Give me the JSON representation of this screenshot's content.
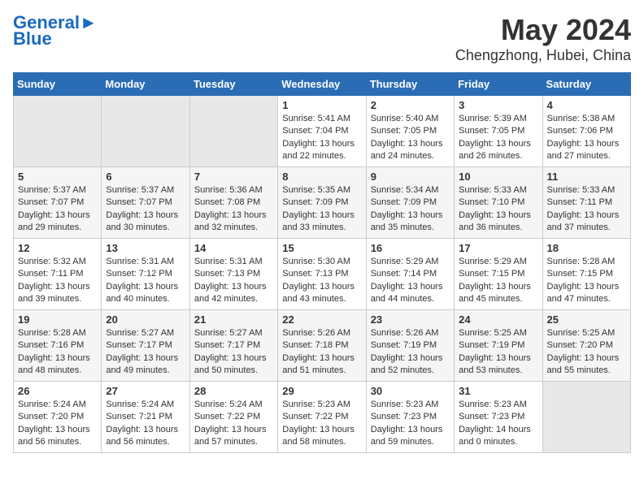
{
  "logo": {
    "line1": "General",
    "line2": "Blue"
  },
  "title": "May 2024",
  "location": "Chengzhong, Hubei, China",
  "days_of_week": [
    "Sunday",
    "Monday",
    "Tuesday",
    "Wednesday",
    "Thursday",
    "Friday",
    "Saturday"
  ],
  "weeks": [
    [
      {
        "day": "",
        "sunrise": "",
        "sunset": "",
        "daylight": ""
      },
      {
        "day": "",
        "sunrise": "",
        "sunset": "",
        "daylight": ""
      },
      {
        "day": "",
        "sunrise": "",
        "sunset": "",
        "daylight": ""
      },
      {
        "day": "1",
        "sunrise": "Sunrise: 5:41 AM",
        "sunset": "Sunset: 7:04 PM",
        "daylight": "Daylight: 13 hours and 22 minutes."
      },
      {
        "day": "2",
        "sunrise": "Sunrise: 5:40 AM",
        "sunset": "Sunset: 7:05 PM",
        "daylight": "Daylight: 13 hours and 24 minutes."
      },
      {
        "day": "3",
        "sunrise": "Sunrise: 5:39 AM",
        "sunset": "Sunset: 7:05 PM",
        "daylight": "Daylight: 13 hours and 26 minutes."
      },
      {
        "day": "4",
        "sunrise": "Sunrise: 5:38 AM",
        "sunset": "Sunset: 7:06 PM",
        "daylight": "Daylight: 13 hours and 27 minutes."
      }
    ],
    [
      {
        "day": "5",
        "sunrise": "Sunrise: 5:37 AM",
        "sunset": "Sunset: 7:07 PM",
        "daylight": "Daylight: 13 hours and 29 minutes."
      },
      {
        "day": "6",
        "sunrise": "Sunrise: 5:37 AM",
        "sunset": "Sunset: 7:07 PM",
        "daylight": "Daylight: 13 hours and 30 minutes."
      },
      {
        "day": "7",
        "sunrise": "Sunrise: 5:36 AM",
        "sunset": "Sunset: 7:08 PM",
        "daylight": "Daylight: 13 hours and 32 minutes."
      },
      {
        "day": "8",
        "sunrise": "Sunrise: 5:35 AM",
        "sunset": "Sunset: 7:09 PM",
        "daylight": "Daylight: 13 hours and 33 minutes."
      },
      {
        "day": "9",
        "sunrise": "Sunrise: 5:34 AM",
        "sunset": "Sunset: 7:09 PM",
        "daylight": "Daylight: 13 hours and 35 minutes."
      },
      {
        "day": "10",
        "sunrise": "Sunrise: 5:33 AM",
        "sunset": "Sunset: 7:10 PM",
        "daylight": "Daylight: 13 hours and 36 minutes."
      },
      {
        "day": "11",
        "sunrise": "Sunrise: 5:33 AM",
        "sunset": "Sunset: 7:11 PM",
        "daylight": "Daylight: 13 hours and 37 minutes."
      }
    ],
    [
      {
        "day": "12",
        "sunrise": "Sunrise: 5:32 AM",
        "sunset": "Sunset: 7:11 PM",
        "daylight": "Daylight: 13 hours and 39 minutes."
      },
      {
        "day": "13",
        "sunrise": "Sunrise: 5:31 AM",
        "sunset": "Sunset: 7:12 PM",
        "daylight": "Daylight: 13 hours and 40 minutes."
      },
      {
        "day": "14",
        "sunrise": "Sunrise: 5:31 AM",
        "sunset": "Sunset: 7:13 PM",
        "daylight": "Daylight: 13 hours and 42 minutes."
      },
      {
        "day": "15",
        "sunrise": "Sunrise: 5:30 AM",
        "sunset": "Sunset: 7:13 PM",
        "daylight": "Daylight: 13 hours and 43 minutes."
      },
      {
        "day": "16",
        "sunrise": "Sunrise: 5:29 AM",
        "sunset": "Sunset: 7:14 PM",
        "daylight": "Daylight: 13 hours and 44 minutes."
      },
      {
        "day": "17",
        "sunrise": "Sunrise: 5:29 AM",
        "sunset": "Sunset: 7:15 PM",
        "daylight": "Daylight: 13 hours and 45 minutes."
      },
      {
        "day": "18",
        "sunrise": "Sunrise: 5:28 AM",
        "sunset": "Sunset: 7:15 PM",
        "daylight": "Daylight: 13 hours and 47 minutes."
      }
    ],
    [
      {
        "day": "19",
        "sunrise": "Sunrise: 5:28 AM",
        "sunset": "Sunset: 7:16 PM",
        "daylight": "Daylight: 13 hours and 48 minutes."
      },
      {
        "day": "20",
        "sunrise": "Sunrise: 5:27 AM",
        "sunset": "Sunset: 7:17 PM",
        "daylight": "Daylight: 13 hours and 49 minutes."
      },
      {
        "day": "21",
        "sunrise": "Sunrise: 5:27 AM",
        "sunset": "Sunset: 7:17 PM",
        "daylight": "Daylight: 13 hours and 50 minutes."
      },
      {
        "day": "22",
        "sunrise": "Sunrise: 5:26 AM",
        "sunset": "Sunset: 7:18 PM",
        "daylight": "Daylight: 13 hours and 51 minutes."
      },
      {
        "day": "23",
        "sunrise": "Sunrise: 5:26 AM",
        "sunset": "Sunset: 7:19 PM",
        "daylight": "Daylight: 13 hours and 52 minutes."
      },
      {
        "day": "24",
        "sunrise": "Sunrise: 5:25 AM",
        "sunset": "Sunset: 7:19 PM",
        "daylight": "Daylight: 13 hours and 53 minutes."
      },
      {
        "day": "25",
        "sunrise": "Sunrise: 5:25 AM",
        "sunset": "Sunset: 7:20 PM",
        "daylight": "Daylight: 13 hours and 55 minutes."
      }
    ],
    [
      {
        "day": "26",
        "sunrise": "Sunrise: 5:24 AM",
        "sunset": "Sunset: 7:20 PM",
        "daylight": "Daylight: 13 hours and 56 minutes."
      },
      {
        "day": "27",
        "sunrise": "Sunrise: 5:24 AM",
        "sunset": "Sunset: 7:21 PM",
        "daylight": "Daylight: 13 hours and 56 minutes."
      },
      {
        "day": "28",
        "sunrise": "Sunrise: 5:24 AM",
        "sunset": "Sunset: 7:22 PM",
        "daylight": "Daylight: 13 hours and 57 minutes."
      },
      {
        "day": "29",
        "sunrise": "Sunrise: 5:23 AM",
        "sunset": "Sunset: 7:22 PM",
        "daylight": "Daylight: 13 hours and 58 minutes."
      },
      {
        "day": "30",
        "sunrise": "Sunrise: 5:23 AM",
        "sunset": "Sunset: 7:23 PM",
        "daylight": "Daylight: 13 hours and 59 minutes."
      },
      {
        "day": "31",
        "sunrise": "Sunrise: 5:23 AM",
        "sunset": "Sunset: 7:23 PM",
        "daylight": "Daylight: 14 hours and 0 minutes."
      },
      {
        "day": "",
        "sunrise": "",
        "sunset": "",
        "daylight": ""
      }
    ]
  ]
}
